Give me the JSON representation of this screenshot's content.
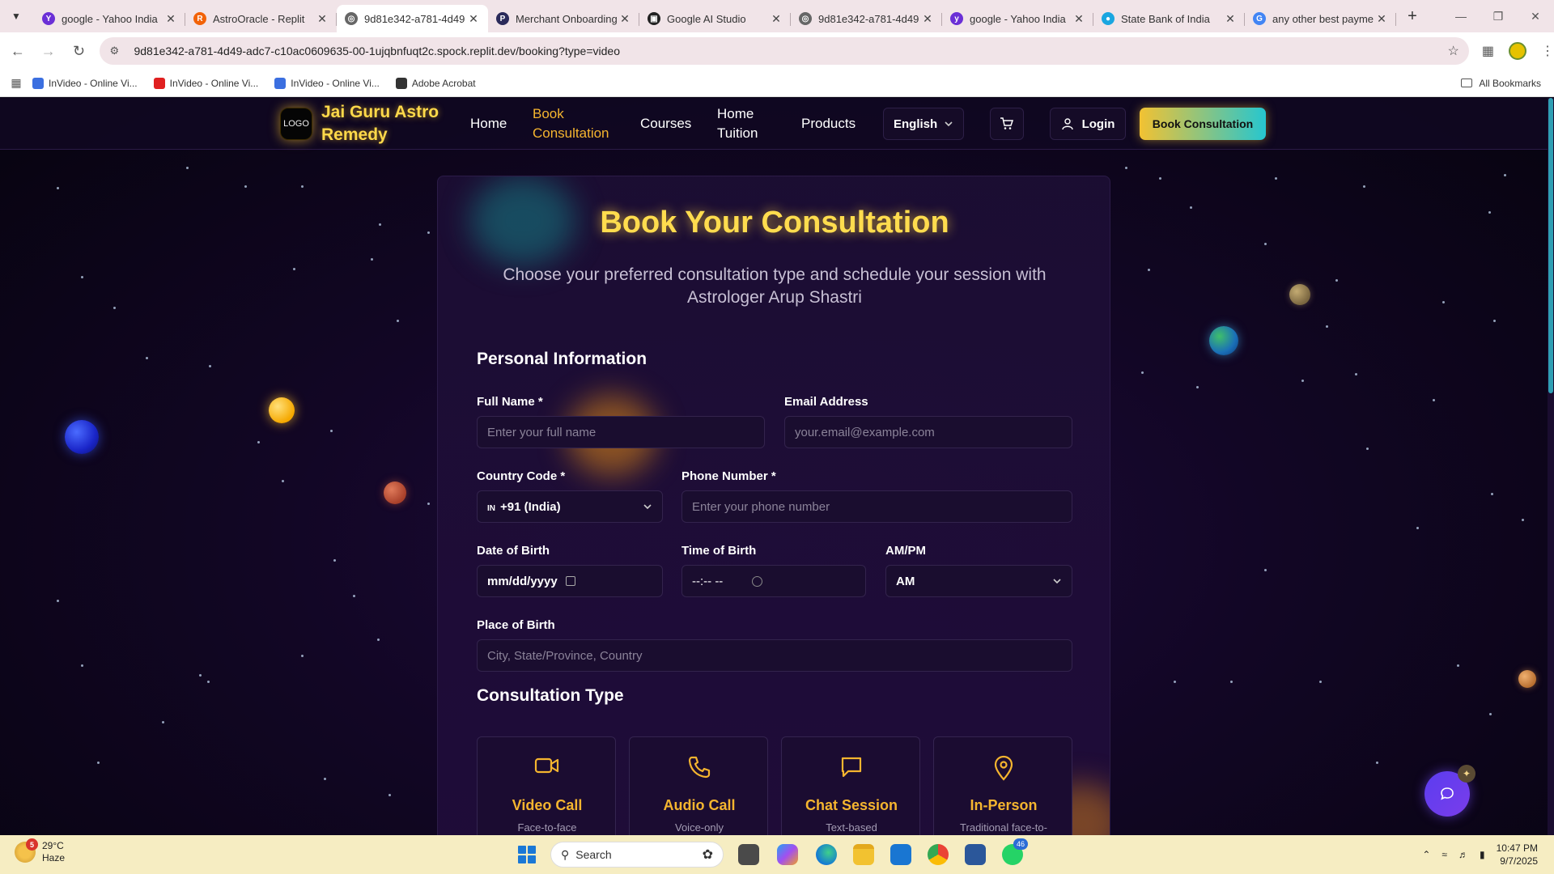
{
  "browser": {
    "tabs": [
      {
        "title": "google - Yahoo India",
        "fav_color": "#6b2fd6",
        "fav_glyph": "Y"
      },
      {
        "title": "AstroOracle - Replit",
        "fav_color": "#f26207",
        "fav_glyph": "R"
      },
      {
        "title": "9d81e342-a781-4d49",
        "fav_color": "#666666",
        "fav_glyph": "◎",
        "active": true
      },
      {
        "title": "Merchant Onboarding",
        "fav_color": "#2a2a5a",
        "fav_glyph": "P"
      },
      {
        "title": "Google AI Studio",
        "fav_color": "#222222",
        "fav_glyph": "▣"
      },
      {
        "title": "9d81e342-a781-4d49",
        "fav_color": "#666666",
        "fav_glyph": "◎"
      },
      {
        "title": "google - Yahoo India",
        "fav_color": "#6b2fd6",
        "fav_glyph": "y"
      },
      {
        "title": "State Bank of India",
        "fav_color": "#1aa6e0",
        "fav_glyph": "●"
      },
      {
        "title": "any other best payme",
        "fav_color": "#4285f4",
        "fav_glyph": "G"
      }
    ],
    "url": "9d81e342-a781-4d49-adc7-c10ac0609635-00-1ujqbnfuqt2c.spock.replit.dev/booking?type=video",
    "bookmarks": [
      {
        "label": "InVideo - Online Vi...",
        "color": "#3b6fe0"
      },
      {
        "label": "InVideo - Online Vi...",
        "color": "#e02020"
      },
      {
        "label": "InVideo - Online Vi...",
        "color": "#3b6fe0"
      },
      {
        "label": "Adobe Acrobat",
        "color": "#333333"
      }
    ],
    "all_bookmarks": "All Bookmarks"
  },
  "site": {
    "logo": "LOGO",
    "brand": "Jai Guru Astro Remedy",
    "nav": {
      "home": "Home",
      "book": "Book Consultation",
      "courses": "Courses",
      "tuition": "Home Tuition",
      "products": "Products"
    },
    "language": "English",
    "login": "Login",
    "cta": "Book Consultation"
  },
  "form": {
    "title": "Book Your Consultation",
    "subtitle": "Choose your preferred consultation type and schedule your session with Astrologer Arup Shastri",
    "personal_heading": "Personal Information",
    "full_name": {
      "label": "Full Name *",
      "placeholder": "Enter your full name"
    },
    "email": {
      "label": "Email Address",
      "placeholder": "your.email@example.com"
    },
    "country_code": {
      "label": "Country Code *",
      "value": "🇮🇳 +91 (India)",
      "flag": "IN",
      "value_text": "+91 (India)"
    },
    "phone": {
      "label": "Phone Number *",
      "placeholder": "Enter your phone number"
    },
    "dob": {
      "label": "Date of Birth",
      "value": "mm/dd/yyyy"
    },
    "tob": {
      "label": "Time of Birth",
      "value": "--:-- --"
    },
    "ampm": {
      "label": "AM/PM",
      "value": "AM"
    },
    "place": {
      "label": "Place of Birth",
      "placeholder": "City, State/Province, Country"
    },
    "consult_heading": "Consultation Type",
    "types": [
      {
        "title": "Video Call",
        "desc": "Face-to-face",
        "icon": "video-icon"
      },
      {
        "title": "Audio Call",
        "desc": "Voice-only",
        "icon": "phone-icon"
      },
      {
        "title": "Chat Session",
        "desc": "Text-based",
        "icon": "chat-icon"
      },
      {
        "title": "In-Person",
        "desc": "Traditional face-to-",
        "icon": "location-icon"
      }
    ]
  },
  "taskbar": {
    "weather_badge": "5",
    "temp": "29°C",
    "condition": "Haze",
    "search": "Search",
    "whatsapp_badge": "46",
    "time": "10:47 PM",
    "date": "9/7/2025"
  }
}
